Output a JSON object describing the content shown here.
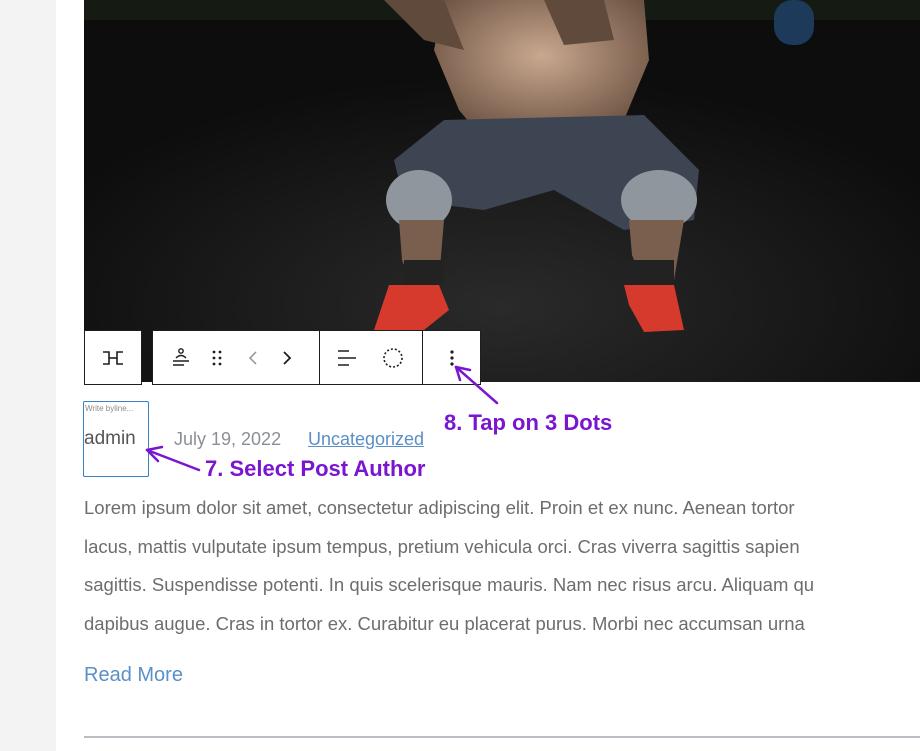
{
  "byline": {
    "placeholder": "Write byline...",
    "author": "admin"
  },
  "post_meta": {
    "date": "July 19, 2022",
    "category": "Uncategorized"
  },
  "excerpt_lines": [
    "Lorem ipsum dolor sit amet, consectetur adipiscing elit. Proin et ex nunc. Aenean tortor",
    "lacus, mattis vulputate ipsum tempus, pretium vehicula orci. Cras viverra sagittis sapien",
    "sagittis. Suspendisse potenti. In quis scelerisque mauris. Nam nec risus arcu. Aliquam qu",
    "dapibus augue. Cras in tortor ex. Curabitur eu placerat purus. Morbi nec accumsan urna"
  ],
  "read_more": "Read More",
  "toolbar": {
    "icons": [
      "post-author-block-icon",
      "post-author-transform-icon",
      "drag-handle-icon",
      "move-left-icon",
      "move-right-icon",
      "align-icon",
      "circle-settings-icon",
      "more-options-icon"
    ]
  },
  "annotations": {
    "step7": "7. Select Post Author",
    "step8": "8. Tap on 3 Dots",
    "color": "#7a16d0"
  },
  "colors": {
    "link": "#5a8fc7",
    "byline_focus": "#3582c4",
    "text": "#6d6d6d"
  }
}
